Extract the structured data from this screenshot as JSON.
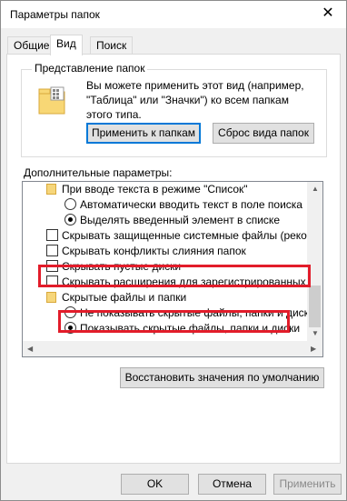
{
  "title": "Параметры папок",
  "tabs": [
    "Общие",
    "Вид",
    "Поиск"
  ],
  "folder_view": {
    "legend": "Представление папок",
    "description": "Вы можете применить этот вид (например, \"Таблица\" или \"Значки\") ко всем папкам этого типа.",
    "apply_button": "Применить к папкам",
    "reset_button": "Сброс вида папок"
  },
  "advanced": {
    "label": "Дополнительные параметры:",
    "items": [
      "При вводе текста в режиме \"Список\"",
      "Автоматически вводить текст в поле поиска",
      "Выделять введенный элемент в списке",
      "Скрывать защищенные системные файлы (рекомен",
      "Скрывать конфликты слияния папок",
      "Скрывать пустые диски",
      "Скрывать расширения для зарегистрированных типо",
      "Скрытые файлы и папки",
      "Не показывать скрытые файлы, папки и диски",
      "Показывать скрытые файлы, папки и диски"
    ]
  },
  "restore_defaults": "Восстановить значения по умолчанию",
  "buttons": {
    "ok": "OK",
    "cancel": "Отмена",
    "apply": "Применить"
  },
  "colors": {
    "highlight": "#e21c2a",
    "default_button_border": "#0078d7"
  }
}
